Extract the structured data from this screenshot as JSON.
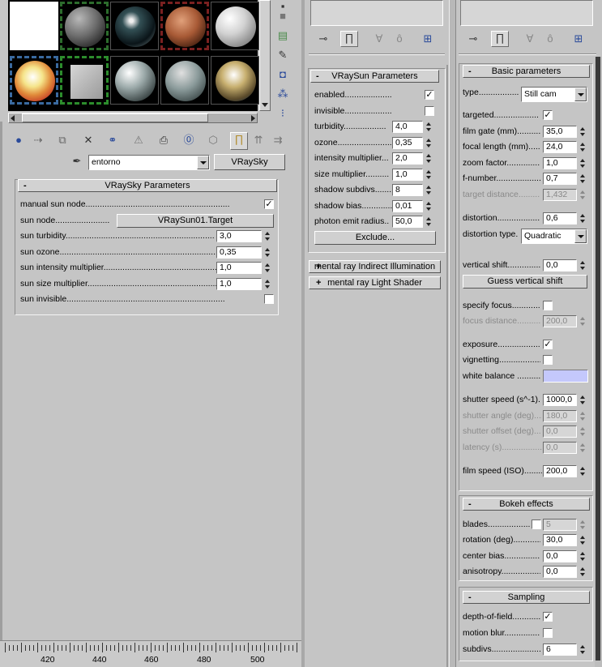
{
  "material_editor": {
    "slot_type_value": "entorno",
    "type_button": "VRaySky",
    "rollout_title": "VRaySky Parameters",
    "rollout_sign": "-",
    "rows": [
      {
        "label": "manual sun node.............................................................",
        "kind": "check",
        "checked": true
      },
      {
        "label": "sun node.......................",
        "kind": "button",
        "value": "VRaySun01.Target"
      },
      {
        "label": "sun turbidity...............................................................",
        "kind": "spin",
        "value": "3,0"
      },
      {
        "label": "sun ozone......................................................................",
        "kind": "spin",
        "value": "0,35"
      },
      {
        "label": "sun intensity multiplier.................................................",
        "kind": "spin",
        "value": "1,0"
      },
      {
        "label": "sun size multiplier.........................................................",
        "kind": "spin",
        "value": "1,0"
      },
      {
        "label": "sun invisible...................................................................",
        "kind": "check",
        "checked": false
      }
    ],
    "ruler_numbers": [
      "420",
      "440",
      "460",
      "480",
      "500"
    ]
  },
  "vraysun": {
    "rollout_title": "VRaySun Parameters",
    "rollout_sign": "-",
    "rows": [
      {
        "label": "enabled..................................",
        "kind": "check",
        "checked": true
      },
      {
        "label": "invisible.................................",
        "kind": "check",
        "checked": false
      },
      {
        "label": "turbidity..................",
        "kind": "spin",
        "value": "4,0"
      },
      {
        "label": "ozone.........................",
        "kind": "spin",
        "value": "0,35"
      },
      {
        "label": "intensity multiplier...",
        "kind": "spin",
        "value": "2,0"
      },
      {
        "label": "size multiplier..........",
        "kind": "spin",
        "value": "1,0"
      },
      {
        "label": "shadow subdivs..........",
        "kind": "spin",
        "value": "8"
      },
      {
        "label": "shadow bias..............",
        "kind": "spin",
        "value": "0,01"
      },
      {
        "label": "photon emit radius..",
        "kind": "spin",
        "value": "50,0"
      }
    ],
    "exclude_button": "Exclude...",
    "collapsed": [
      {
        "sign": "+",
        "title": "mental ray Indirect Illumination"
      },
      {
        "sign": "+",
        "title": "mental ray Light Shader"
      }
    ]
  },
  "camera": {
    "basic": {
      "title": "Basic parameters",
      "sign": "-",
      "type_label": "type.................",
      "type_value": "Still cam",
      "rows": [
        {
          "label": "targeted...................",
          "kind": "check",
          "checked": true
        },
        {
          "label": "film gate (mm).............",
          "kind": "spin",
          "value": "35,0"
        },
        {
          "label": "focal length (mm).......",
          "kind": "spin",
          "value": "24,0"
        },
        {
          "label": "zoom factor...................",
          "kind": "spin",
          "value": "1,0"
        },
        {
          "label": "f-number........................",
          "kind": "spin",
          "value": "0,7"
        },
        {
          "label": "target distance..........",
          "kind": "spin",
          "value": "1,432",
          "disabled": true
        },
        {
          "label": "distortion......................",
          "kind": "spin",
          "value": "0,6"
        }
      ],
      "distortion_type_label": "distortion type.",
      "distortion_type_value": "Quadratic",
      "vertical_shift_label": "vertical shift...............",
      "vertical_shift_value": "0,0",
      "guess_button": "Guess vertical shift",
      "rows2": [
        {
          "label": "specify focus.................",
          "kind": "check",
          "checked": false
        },
        {
          "label": "focus distance...............",
          "kind": "spin",
          "value": "200,0",
          "disabled": true
        },
        {
          "label": "exposure.......................",
          "kind": "check",
          "checked": true
        },
        {
          "label": "vignetting.....................",
          "kind": "check",
          "checked": false
        }
      ],
      "white_balance_label": "white balance ..........",
      "white_balance_color": "#c4c8fc",
      "rows3": [
        {
          "label": "shutter speed (s^-1).",
          "kind": "spin",
          "value": "1000,0"
        },
        {
          "label": "shutter angle (deg)....",
          "kind": "spin",
          "value": "180,0",
          "disabled": true
        },
        {
          "label": "shutter offset (deg)...",
          "kind": "spin",
          "value": "0,0",
          "disabled": true
        },
        {
          "label": "latency (s).....................",
          "kind": "spin",
          "value": "0,0",
          "disabled": true
        },
        {
          "label": "film speed (ISO).........",
          "kind": "spin",
          "value": "200,0"
        }
      ]
    },
    "bokeh": {
      "title": "Bokeh effects",
      "sign": "-",
      "blades_label": "blades..................",
      "blades_checked": false,
      "blades_value": "5",
      "rows": [
        {
          "label": "rotation (deg)................",
          "kind": "spin",
          "value": "30,0"
        },
        {
          "label": "center bias....................",
          "kind": "spin",
          "value": "0,0"
        },
        {
          "label": "anisotropy.....................",
          "kind": "spin",
          "value": "0,0"
        }
      ]
    },
    "sampling": {
      "title": "Sampling",
      "sign": "-",
      "rows": [
        {
          "label": "depth-of-field.............",
          "kind": "check",
          "checked": true
        },
        {
          "label": "motion blur..................",
          "kind": "check",
          "checked": false
        },
        {
          "label": "subdivs.........................",
          "kind": "spin",
          "value": "6"
        }
      ]
    }
  },
  "icons": [
    "pin-icon",
    "stack-icon",
    "funnel-icon",
    "lock-icon",
    "configure-icon",
    "close-icon",
    "material-icon"
  ]
}
